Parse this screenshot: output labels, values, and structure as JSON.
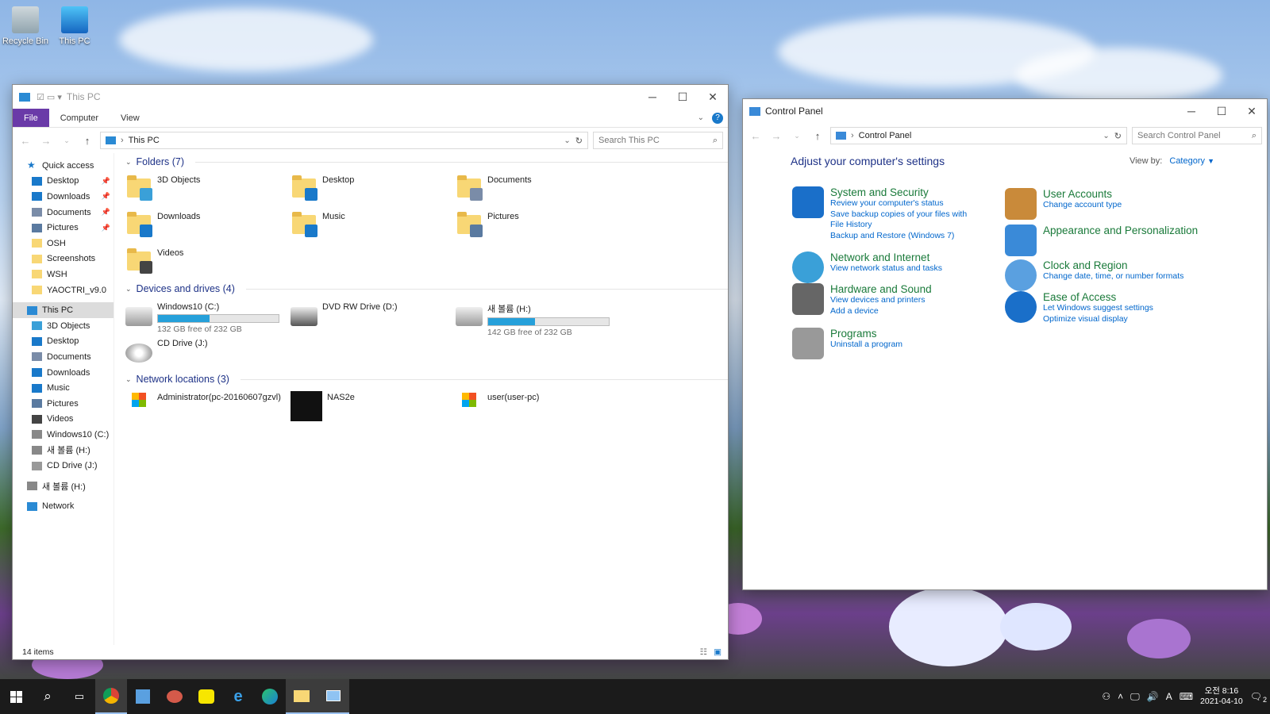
{
  "desktop": {
    "icons": [
      {
        "label": "Recycle Bin",
        "icon": "recycle-bin-icon"
      },
      {
        "label": "This PC",
        "icon": "this-pc-icon"
      }
    ]
  },
  "explorer": {
    "title": "This PC",
    "ribbon_tabs": [
      "File",
      "Computer",
      "View"
    ],
    "address": "This PC",
    "search_placeholder": "Search This PC",
    "nav": [
      {
        "label": "Quick access",
        "icon": "star-icon",
        "top": true,
        "pinned": false
      },
      {
        "label": "Desktop",
        "icon": "desktop-icon",
        "pinned": true
      },
      {
        "label": "Downloads",
        "icon": "download-icon",
        "pinned": true
      },
      {
        "label": "Documents",
        "icon": "document-icon",
        "pinned": true
      },
      {
        "label": "Pictures",
        "icon": "pictures-icon",
        "pinned": true
      },
      {
        "label": "OSH",
        "icon": "folder-icon",
        "pinned": false
      },
      {
        "label": "Screenshots",
        "icon": "folder-icon",
        "pinned": false
      },
      {
        "label": "WSH",
        "icon": "folder-icon",
        "pinned": false
      },
      {
        "label": "YAOCTRI_v9.0",
        "icon": "folder-icon",
        "pinned": false
      },
      {
        "label": "This PC",
        "icon": "pc-icon",
        "top": true,
        "selected": true
      },
      {
        "label": "3D Objects",
        "icon": "3d-objects-icon"
      },
      {
        "label": "Desktop",
        "icon": "desktop-icon"
      },
      {
        "label": "Documents",
        "icon": "document-icon"
      },
      {
        "label": "Downloads",
        "icon": "download-icon"
      },
      {
        "label": "Music",
        "icon": "music-icon"
      },
      {
        "label": "Pictures",
        "icon": "pictures-icon"
      },
      {
        "label": "Videos",
        "icon": "videos-icon"
      },
      {
        "label": "Windows10 (C:)",
        "icon": "drive-icon"
      },
      {
        "label": "새 볼륨 (H:)",
        "icon": "drive-icon"
      },
      {
        "label": "CD Drive (J:)",
        "icon": "cd-icon"
      },
      {
        "label": "새 볼륨 (H:)",
        "icon": "drive-icon",
        "top": true
      },
      {
        "label": "Network",
        "icon": "network-icon",
        "top": true
      }
    ],
    "folders_header": "Folders (7)",
    "folders": [
      {
        "label": "3D Objects",
        "icon": "3d-objects-icon"
      },
      {
        "label": "Desktop",
        "icon": "desktop-icon"
      },
      {
        "label": "Documents",
        "icon": "document-icon"
      },
      {
        "label": "Downloads",
        "icon": "download-icon"
      },
      {
        "label": "Music",
        "icon": "music-icon"
      },
      {
        "label": "Pictures",
        "icon": "pictures-icon"
      },
      {
        "label": "Videos",
        "icon": "videos-icon"
      }
    ],
    "drives_header": "Devices and drives (4)",
    "drives": [
      {
        "label": "Windows10 (C:)",
        "free": "132 GB free of 232 GB",
        "used_fraction": 0.43,
        "icon": "windows-drive-icon"
      },
      {
        "label": "DVD RW Drive (D:)",
        "icon": "dvd-drive-icon"
      },
      {
        "label": "새 볼륨 (H:)",
        "free": "142 GB free of 232 GB",
        "used_fraction": 0.39,
        "icon": "drive-icon"
      },
      {
        "label": "CD Drive (J:)",
        "icon": "cd-drive-icon"
      }
    ],
    "network_header": "Network locations (3)",
    "network": [
      {
        "label": "Administrator(pc-20160607gzvl)",
        "icon": "windows-media-player-icon"
      },
      {
        "label": "NAS2e",
        "icon": "iptime-icon"
      },
      {
        "label": "user(user-pc)",
        "icon": "windows-media-player-icon"
      }
    ],
    "status": "14 items"
  },
  "control_panel": {
    "title": "Control Panel",
    "address": "Control Panel",
    "search_placeholder": "Search Control Panel",
    "heading": "Adjust your computer's settings",
    "view_by_label": "View by:",
    "view_by_value": "Category",
    "left": [
      {
        "title": "System and Security",
        "icon": "shield-icon",
        "links": [
          "Review your computer's status",
          "Save backup copies of your files with File History",
          "Backup and Restore (Windows 7)"
        ]
      },
      {
        "title": "Network and Internet",
        "icon": "network-globe-icon",
        "links": [
          "View network status and tasks"
        ]
      },
      {
        "title": "Hardware and Sound",
        "icon": "printer-icon",
        "links": [
          "View devices and printers",
          "Add a device"
        ]
      },
      {
        "title": "Programs",
        "icon": "programs-icon",
        "links": [
          "Uninstall a program"
        ]
      }
    ],
    "right": [
      {
        "title": "User Accounts",
        "icon": "users-icon",
        "links": [
          "Change account type"
        ]
      },
      {
        "title": "Appearance and Personalization",
        "icon": "appearance-icon",
        "links": []
      },
      {
        "title": "Clock and Region",
        "icon": "clock-globe-icon",
        "links": [
          "Change date, time, or number formats"
        ]
      },
      {
        "title": "Ease of Access",
        "icon": "ease-of-access-icon",
        "links": [
          "Let Windows suggest settings",
          "Optimize visual display"
        ]
      }
    ]
  },
  "taskbar": {
    "time": "오전 8:16",
    "date": "2021-04-10",
    "ime": "A",
    "notif_count": "2"
  }
}
